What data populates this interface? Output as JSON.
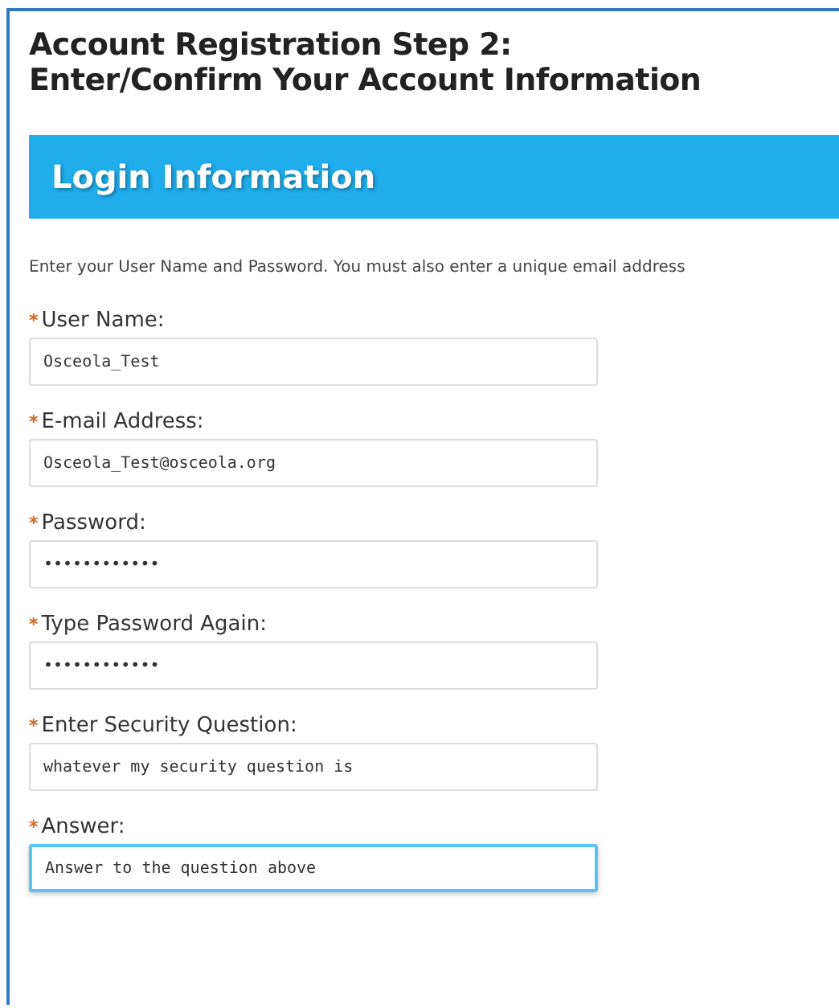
{
  "page_title": [
    "Account Registration Step 2:",
    "Enter/Confirm Your Account Information"
  ],
  "section": {
    "title": "Login Information",
    "intro": "Enter your User Name and Password.  You must also enter a unique email address"
  },
  "fields": [
    {
      "label": "User Name:",
      "marker": "*",
      "value": "Osceola_Test",
      "focused": false
    },
    {
      "label": "E-mail Address:",
      "marker": "*",
      "value": "Osceola_Test@osceola.org",
      "focused": false
    },
    {
      "label": "Password:",
      "marker": "*",
      "value": "••••••••••••",
      "focused": false
    },
    {
      "label": "Type Password Again:",
      "marker": "*",
      "value": "••••••••••••",
      "focused": false
    },
    {
      "label": "Enter Security Question:",
      "marker": "*",
      "value": "whatever my security question is",
      "focused": false
    },
    {
      "label": "Answer:",
      "marker": "*",
      "value": "Answer to the question above",
      "focused": true
    }
  ]
}
